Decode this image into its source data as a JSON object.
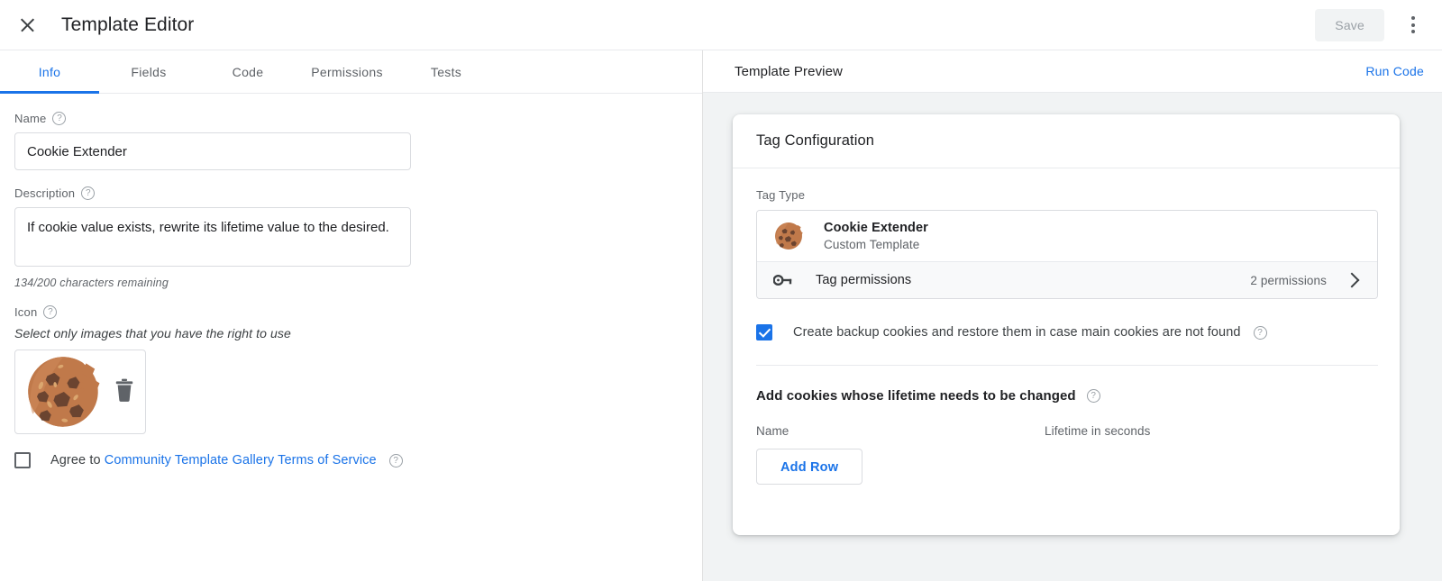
{
  "topbar": {
    "title": "Template Editor",
    "close_label": "Close",
    "save_label": "Save",
    "more_label": "More options"
  },
  "tabs": [
    {
      "label": "Info",
      "active": true
    },
    {
      "label": "Fields",
      "active": false
    },
    {
      "label": "Code",
      "active": false
    },
    {
      "label": "Permissions",
      "active": false
    },
    {
      "label": "Tests",
      "active": false
    }
  ],
  "form": {
    "name": {
      "label": "Name",
      "value": "Cookie Extender",
      "placeholder": ""
    },
    "description": {
      "label": "Description",
      "value": "If cookie value exists, rewrite its lifetime value to the desired.",
      "placeholder": "",
      "counter": "134/200 characters remaining"
    },
    "icon": {
      "label": "Icon",
      "hint": "Select only images that you have the right to use",
      "delete_label": "Delete icon"
    },
    "agree": {
      "prefix": "Agree to ",
      "link_text": "Community Template Gallery Terms of Service",
      "checked": false
    }
  },
  "preview": {
    "header_title": "Template Preview",
    "run_code_label": "Run Code",
    "card": {
      "title": "Tag Configuration",
      "tag_type_label": "Tag Type",
      "tag_name": "Cookie Extender",
      "tag_subtitle": "Custom Template",
      "permissions_label": "Tag permissions",
      "permissions_count": "2 permissions",
      "backup_checkbox": {
        "label": "Create backup cookies and restore them in case main cookies are not found",
        "checked": true
      },
      "cookies_section_title": "Add cookies whose lifetime needs to be changed",
      "table": {
        "columns": [
          "Name",
          "Lifetime in seconds"
        ],
        "rows": []
      },
      "add_row_label": "Add Row"
    }
  },
  "colors": {
    "accent_blue": "#1a73e8",
    "text_primary": "#202124",
    "text_secondary": "#5f6368",
    "panel_bg": "#f1f3f4",
    "border": "#dadce0"
  }
}
